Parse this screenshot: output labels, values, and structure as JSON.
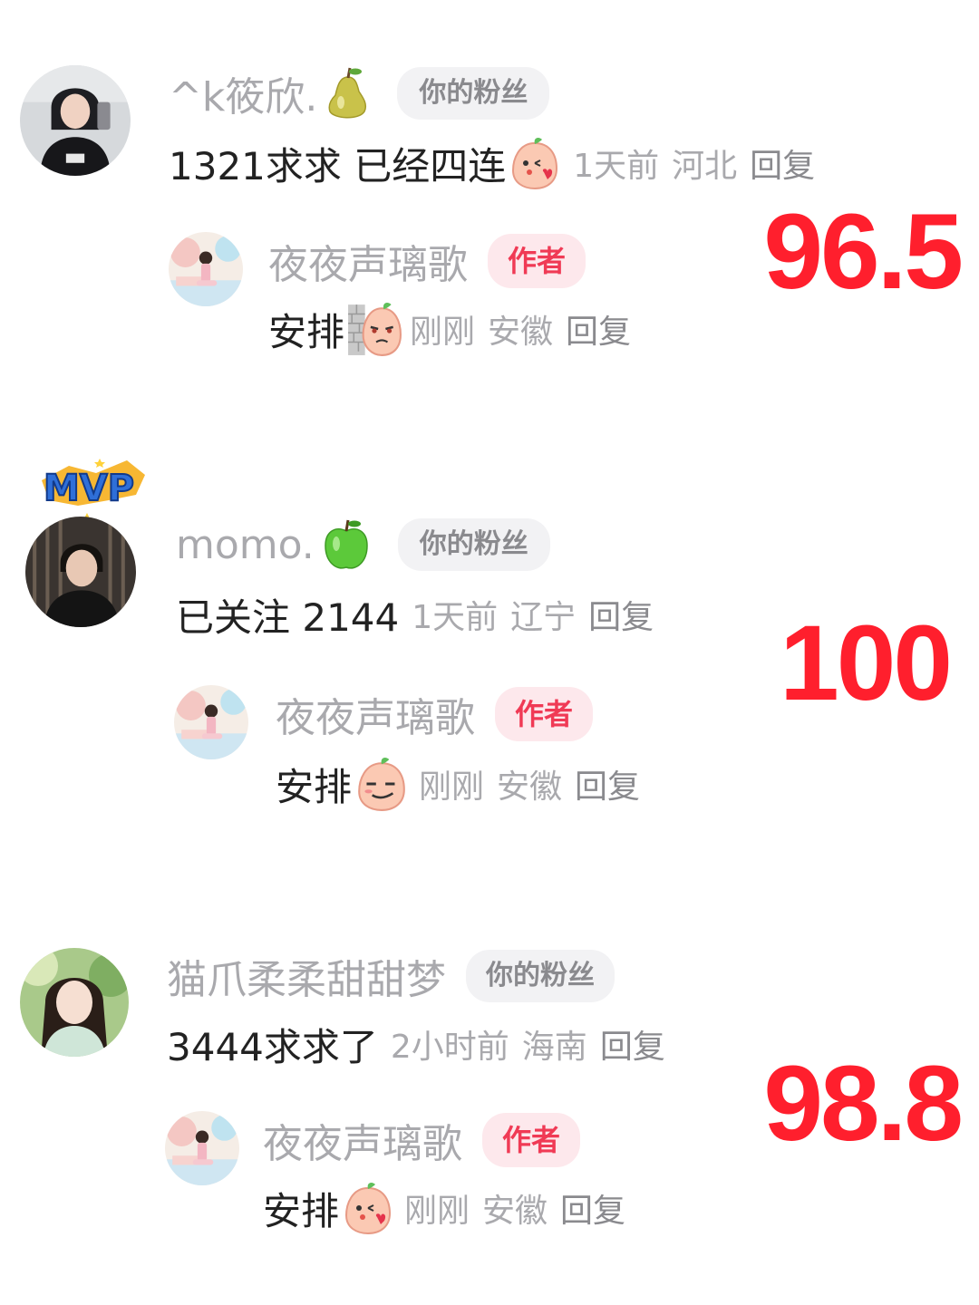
{
  "comments": [
    {
      "username": "^k筱欣.",
      "username_icon": "pear-icon",
      "fan_badge": "你的粉丝",
      "text": "1321求求 已经四连",
      "text_icon": "peach-kiss-emoji",
      "time": "1天前",
      "location": "河北",
      "reply_label": "回复",
      "score": "96.5",
      "reply": {
        "username": "夜夜声璃歌",
        "author_badge": "作者",
        "text": "安排",
        "text_icon": "peek-wall-emoji",
        "time": "刚刚",
        "location": "安徽",
        "reply_label": "回复"
      }
    },
    {
      "username": "momo.",
      "username_icon": "green-apple-icon",
      "fan_badge": "你的粉丝",
      "avatar_badge": "MVP",
      "text": "已关注 2144",
      "time": "1天前",
      "location": "辽宁",
      "reply_label": "回复",
      "score": "100",
      "reply": {
        "username": "夜夜声璃歌",
        "author_badge": "作者",
        "text": "安排",
        "text_icon": "peach-smirk-emoji",
        "time": "刚刚",
        "location": "安徽",
        "reply_label": "回复"
      }
    },
    {
      "username": "猫爪柔柔甜甜梦",
      "fan_badge": "你的粉丝",
      "text": "3444求求了",
      "time": "2小时前",
      "location": "海南",
      "reply_label": "回复",
      "score": "98.8",
      "reply": {
        "username": "夜夜声璃歌",
        "author_badge": "作者",
        "text": "安排",
        "text_icon": "peach-kiss-emoji",
        "time": "刚刚",
        "location": "安徽",
        "reply_label": "回复"
      }
    }
  ],
  "colors": {
    "score": "#ff1f2d",
    "author_badge_text": "#f03a55",
    "author_badge_bg": "#fde8ec",
    "fan_badge_bg": "#f2f2f4",
    "meta_text": "#a9a9ad"
  }
}
